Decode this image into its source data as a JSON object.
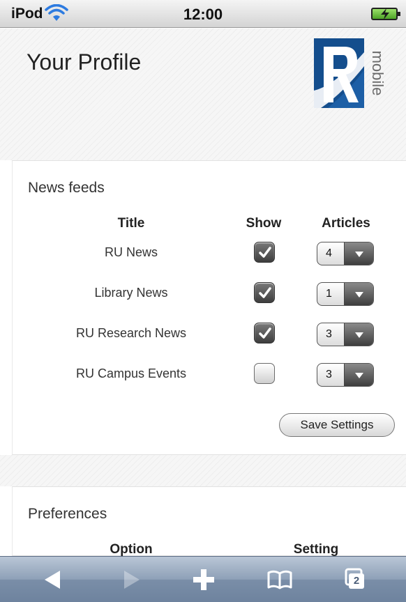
{
  "status_bar": {
    "device": "iPod",
    "time": "12:00"
  },
  "header": {
    "title": "Your Profile",
    "logo_text": "mobile"
  },
  "news_feeds": {
    "section_title": "News feeds",
    "columns": {
      "title": "Title",
      "show": "Show",
      "articles": "Articles"
    },
    "feeds": [
      {
        "title": "RU News",
        "show": true,
        "articles": "4"
      },
      {
        "title": "Library News",
        "show": true,
        "articles": "1"
      },
      {
        "title": "RU Research News",
        "show": true,
        "articles": "3"
      },
      {
        "title": "RU Campus Events",
        "show": false,
        "articles": "3"
      }
    ],
    "save_label": "Save Settings"
  },
  "preferences": {
    "section_title": "Preferences",
    "columns": {
      "option": "Option",
      "setting": "Setting"
    }
  },
  "toolbar": {
    "tab_count": "2"
  },
  "colors": {
    "logo_blue": "#1d5fa6",
    "logo_dark_blue": "#0d3f78",
    "toolbar_blue": "#8ea0b7"
  }
}
